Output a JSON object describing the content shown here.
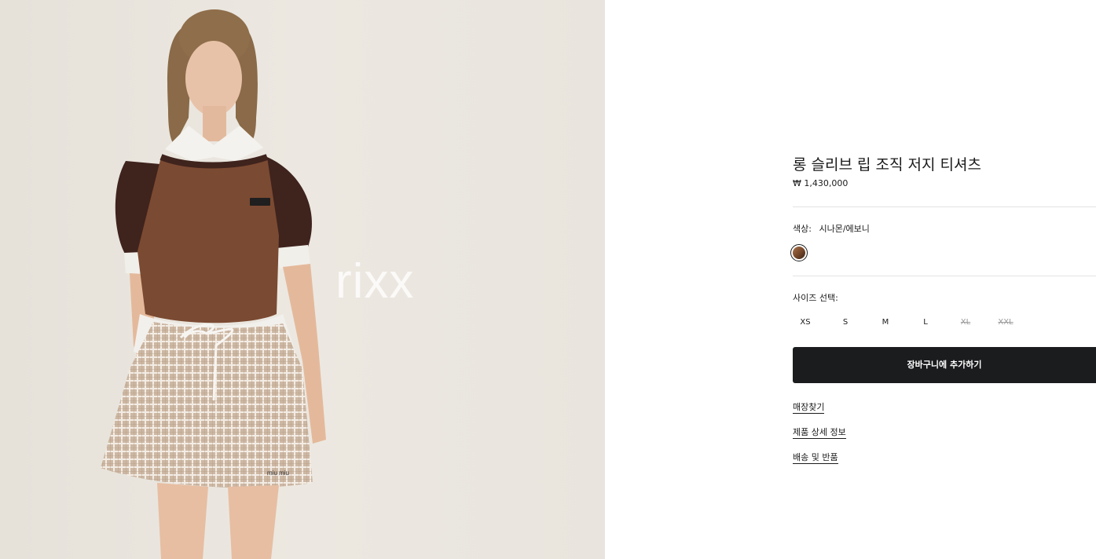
{
  "hero": {
    "watermark": "rixx",
    "skirt_logo": "miu miu"
  },
  "product": {
    "title": "롱 슬리브 립 조직 저지 티셔츠",
    "price": "₩ 1,430,000"
  },
  "color": {
    "label": "색상:",
    "value": "시나몬/에보니",
    "swatch_colors": [
      "#a9724b",
      "#3c2418"
    ]
  },
  "sizes": {
    "label": "사이즈 선택:",
    "options": [
      {
        "label": "XS",
        "available": true
      },
      {
        "label": "S",
        "available": true
      },
      {
        "label": "M",
        "available": true
      },
      {
        "label": "L",
        "available": true
      },
      {
        "label": "XL",
        "available": false
      },
      {
        "label": "XXL",
        "available": false
      }
    ]
  },
  "actions": {
    "add_to_cart": "장바구니에 추가하기"
  },
  "links": {
    "store_locator": "매장찾기",
    "product_details": "제품 상세 정보",
    "shipping_returns": "배송 및 반품"
  },
  "colors": {
    "button_bg": "#1b1c1e",
    "text": "#1b1b1b",
    "divider": "#e3e3e3",
    "unavailable": "#9a9a9a"
  }
}
